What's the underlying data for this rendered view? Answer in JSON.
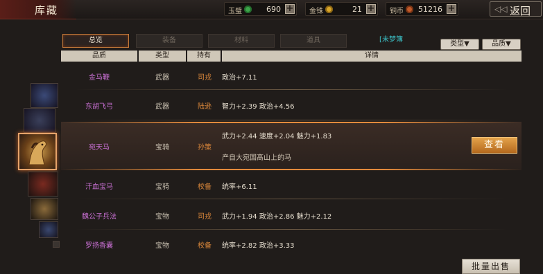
{
  "window": {
    "title": "库藏",
    "back_label": "返回"
  },
  "resources": [
    {
      "label": "玉璧",
      "value": "690",
      "icon": "jade-coin-icon",
      "color": "#3ca54a"
    },
    {
      "label": "金铢",
      "value": "21",
      "icon": "gold-coin-icon",
      "color": "#d9a62a"
    },
    {
      "label": "铜币",
      "value": "51216",
      "icon": "copper-coin-icon",
      "color": "#c05a2a"
    }
  ],
  "tabs": [
    {
      "label": "总览",
      "active": true
    },
    {
      "label": "装备",
      "active": false
    },
    {
      "label": "材料",
      "active": false
    },
    {
      "label": "道具",
      "active": false
    },
    {
      "label": "[未梦簿",
      "active": false
    }
  ],
  "filters": {
    "type_label": "类型▼",
    "quality_label": "品质▼"
  },
  "table": {
    "headers": [
      "品质",
      "类型",
      "持有",
      "详情"
    ],
    "rows": [
      {
        "name": "金马鞭",
        "type": "武器",
        "owner": "司戎",
        "detail": "政治+7.11"
      },
      {
        "name": "东胡飞弓",
        "type": "武器",
        "owner": "陆逊",
        "detail": "智力+2.39  政治+4.56"
      },
      {
        "name": "宛天马",
        "type": "宝骑",
        "owner": "孙策",
        "detail": "武力+2.44  速度+2.04  魅力+1.83",
        "desc": "产自大宛国高山上的马"
      },
      {
        "name": "汗血宝马",
        "type": "宝骑",
        "owner": "校备",
        "detail": "统率+6.11"
      },
      {
        "name": "魏公子兵法",
        "type": "宝物",
        "owner": "司戎",
        "detail": "武力+1.94  政治+2.86  魅力+2.12"
      },
      {
        "name": "罗扬香囊",
        "type": "宝物",
        "owner": "校备",
        "detail": "统率+2.82  政治+3.33"
      }
    ]
  },
  "actions": {
    "view_label": "查看",
    "bulk_sell_label": "批量出售"
  }
}
